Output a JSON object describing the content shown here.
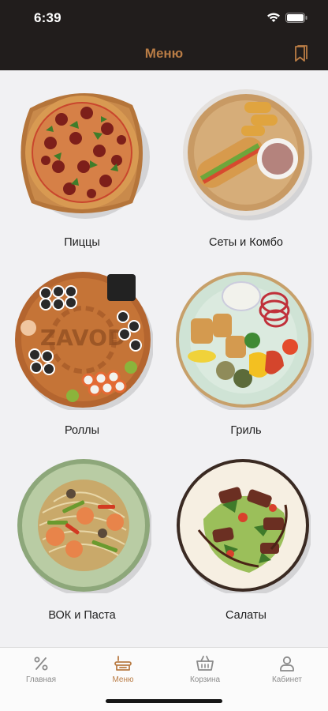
{
  "status": {
    "time": "6:39"
  },
  "header": {
    "title": "Меню"
  },
  "colors": {
    "accent": "#b97c45",
    "header_bg": "#211d1c",
    "background": "#f1f1f3"
  },
  "categories": [
    {
      "label": "Пиццы",
      "icon": "pizza-image"
    },
    {
      "label": "Сеты и Комбо",
      "icon": "combo-set-image"
    },
    {
      "label": "Роллы",
      "icon": "rolls-image"
    },
    {
      "label": "Гриль",
      "icon": "grill-image"
    },
    {
      "label": "ВОК и Паста",
      "icon": "wok-pasta-image"
    },
    {
      "label": "Салаты",
      "icon": "salad-image"
    }
  ],
  "rolls_board_text": "ZAVOD",
  "tabs": [
    {
      "label": "Главная",
      "icon": "percent-icon",
      "active": false
    },
    {
      "label": "Меню",
      "icon": "menu-dish-icon",
      "active": true
    },
    {
      "label": "Корзина",
      "icon": "basket-icon",
      "active": false
    },
    {
      "label": "Кабинет",
      "icon": "user-icon",
      "active": false
    }
  ]
}
